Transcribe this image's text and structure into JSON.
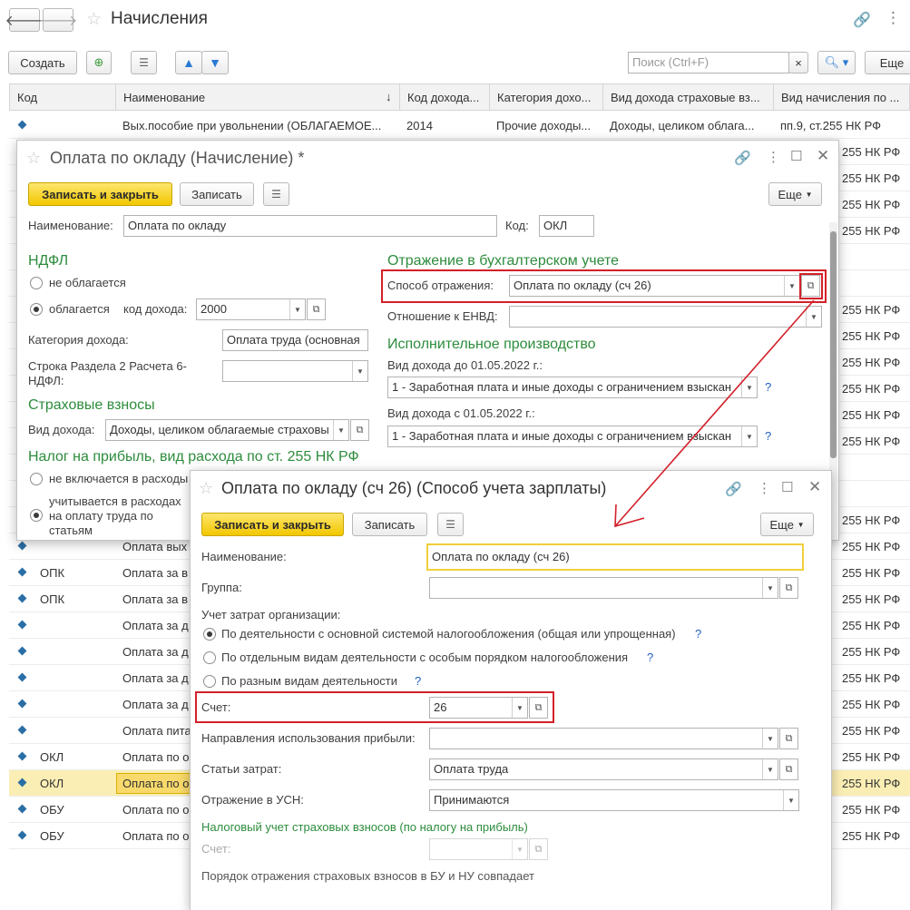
{
  "main": {
    "title": "Начисления",
    "toolbar": {
      "create": "Создать",
      "search_placeholder": "Поиск (Ctrl+F)",
      "search_clear": "×",
      "more": "Еще"
    },
    "columns": [
      "Код",
      "Наименование",
      "Код дохода...",
      "Категория дохо...",
      "Вид дохода страховые вз...",
      "Вид начисления по ..."
    ],
    "sort_arrow": "↓",
    "rows": [
      {
        "code": "",
        "name": "Вых.пособие при увольнении (ОБЛАГАЕМОЕ...",
        "income_code": "2014",
        "category": "Прочие доходы...",
        "insurance": "Доходы, целиком облага...",
        "article": "пп.9, ст.255 НК РФ"
      },
      {
        "code": "",
        "name": "",
        "article": "255 НК РФ"
      },
      {
        "code": "",
        "name": "",
        "article": "255 НК РФ"
      },
      {
        "code": "",
        "name": "",
        "article": "255 НК РФ"
      },
      {
        "code": "",
        "name": "",
        "article": "255 НК РФ"
      },
      {
        "code": "",
        "name": "",
        "article": ""
      },
      {
        "code": "",
        "name": "",
        "article": ""
      },
      {
        "code": "",
        "name": "",
        "article": "255 НК РФ"
      },
      {
        "code": "",
        "name": "",
        "article": "255 НК РФ"
      },
      {
        "code": "",
        "name": "",
        "article": "255 НК РФ"
      },
      {
        "code": "",
        "name": "",
        "article": "255 НК РФ"
      },
      {
        "code": "",
        "name": "",
        "article": "255 НК РФ"
      },
      {
        "code": "",
        "name": "",
        "article": "255 НК РФ"
      },
      {
        "code": "",
        "name": "",
        "article": ""
      },
      {
        "code": "",
        "name": "Натуральн",
        "article": ""
      },
      {
        "code": "",
        "name": "Оплата вых",
        "article": "255 НК РФ"
      },
      {
        "code": "",
        "name": "Оплата вых",
        "article": "255 НК РФ"
      },
      {
        "code": "ОПК",
        "name": "Оплата за в",
        "article": "255 НК РФ"
      },
      {
        "code": "ОПК",
        "name": "Оплата за в",
        "article": "255 НК РФ"
      },
      {
        "code": "",
        "name": "Оплата за д",
        "article": "255 НК РФ"
      },
      {
        "code": "",
        "name": "Оплата за д",
        "article": "255 НК РФ"
      },
      {
        "code": "",
        "name": "Оплата за д",
        "article": "255 НК РФ"
      },
      {
        "code": "",
        "name": "Оплата за д",
        "article": "255 НК РФ"
      },
      {
        "code": "",
        "name": "Оплата пита",
        "article": "255 НК РФ"
      },
      {
        "code": "ОКЛ",
        "name": "Оплата по о",
        "article": "255 НК РФ"
      },
      {
        "code": "ОКЛ",
        "name": "Оплата по о",
        "article": "255 НК РФ"
      },
      {
        "code": "ОБУ",
        "name": "Оплата по о",
        "article": "255 НК РФ"
      },
      {
        "code": "ОБУ",
        "name": "Оплата по о",
        "article": "255 НК РФ"
      }
    ]
  },
  "dialog1": {
    "title": "Оплата по окладу (Начисление) *",
    "btn_save_close": "Записать и закрыть",
    "btn_save": "Записать",
    "btn_more": "Еще",
    "name_label": "Наименование:",
    "name_value": "Оплата по окладу",
    "code_label": "Код:",
    "code_value": "ОКЛ",
    "ndfl_title": "НДФЛ",
    "ndfl_opt1": "не облагается",
    "ndfl_opt2": "облагается",
    "income_code_label": "код дохода:",
    "income_code_value": "2000",
    "income_cat_label": "Категория дохода:",
    "income_cat_value": "Оплата труда (основная",
    "section2_label": "Строка Раздела 2 Расчета 6-НДФЛ:",
    "ins_title": "Страховые взносы",
    "ins_income_label": "Вид дохода:",
    "ins_income_value": "Доходы, целиком облагаемые страховы",
    "tax_title": "Налог на прибыль, вид расхода по ст. 255 НК РФ",
    "tax_opt1": "не включается в расходы",
    "tax_opt2": "учитывается в расходах на оплату труда по статьям",
    "acc_title": "Отражение в бухгалтерском учете",
    "method_label": "Способ отражения:",
    "method_value": "Оплата по окладу (сч 26)",
    "envd_label": "Отношение к ЕНВД:",
    "exec_title": "Исполнительное производство",
    "before_label": "Вид дохода до 01.05.2022 г.:",
    "before_value": "1 - Заработная плата и иные доходы с ограничением взыскан",
    "after_label": "Вид дохода с 01.05.2022 г.:",
    "after_value": "1 - Заработная плата и иные доходы с ограничением взыскан",
    "q": "?"
  },
  "dialog2": {
    "title": "Оплата по окладу (сч 26) (Способ учета зарплаты)",
    "btn_save_close": "Записать и закрыть",
    "btn_save": "Записать",
    "btn_more": "Еще",
    "name_label": "Наименование:",
    "name_value": "Оплата по окладу (сч 26)",
    "group_label": "Группа:",
    "cost_label": "Учет затрат организации:",
    "opt1": "По деятельности с основной системой налогообложения (общая или упрощенная)",
    "opt2": "По отдельным видам деятельности с особым порядком налогообложения",
    "opt3": "По разным видам деятельности",
    "account_label": "Счет:",
    "account_value": "26",
    "profit_label": "Направления использования прибыли:",
    "cost_items_label": "Статьи затрат:",
    "cost_items_value": "Оплата труда",
    "usn_label": "Отражение в УСН:",
    "usn_value": "Принимаются",
    "ins_title": "Налоговый учет страховых взносов (по налогу на прибыль)",
    "ins_account_label": "Счет:",
    "note": "Порядок отражения страховых взносов в БУ и НУ совпадает",
    "q": "?"
  },
  "colors": {
    "accent_green": "#2d8c3c",
    "highlight_red": "#d3202a",
    "button_yellow": "#f5cc1a",
    "selected_row": "#fbeeb4"
  }
}
